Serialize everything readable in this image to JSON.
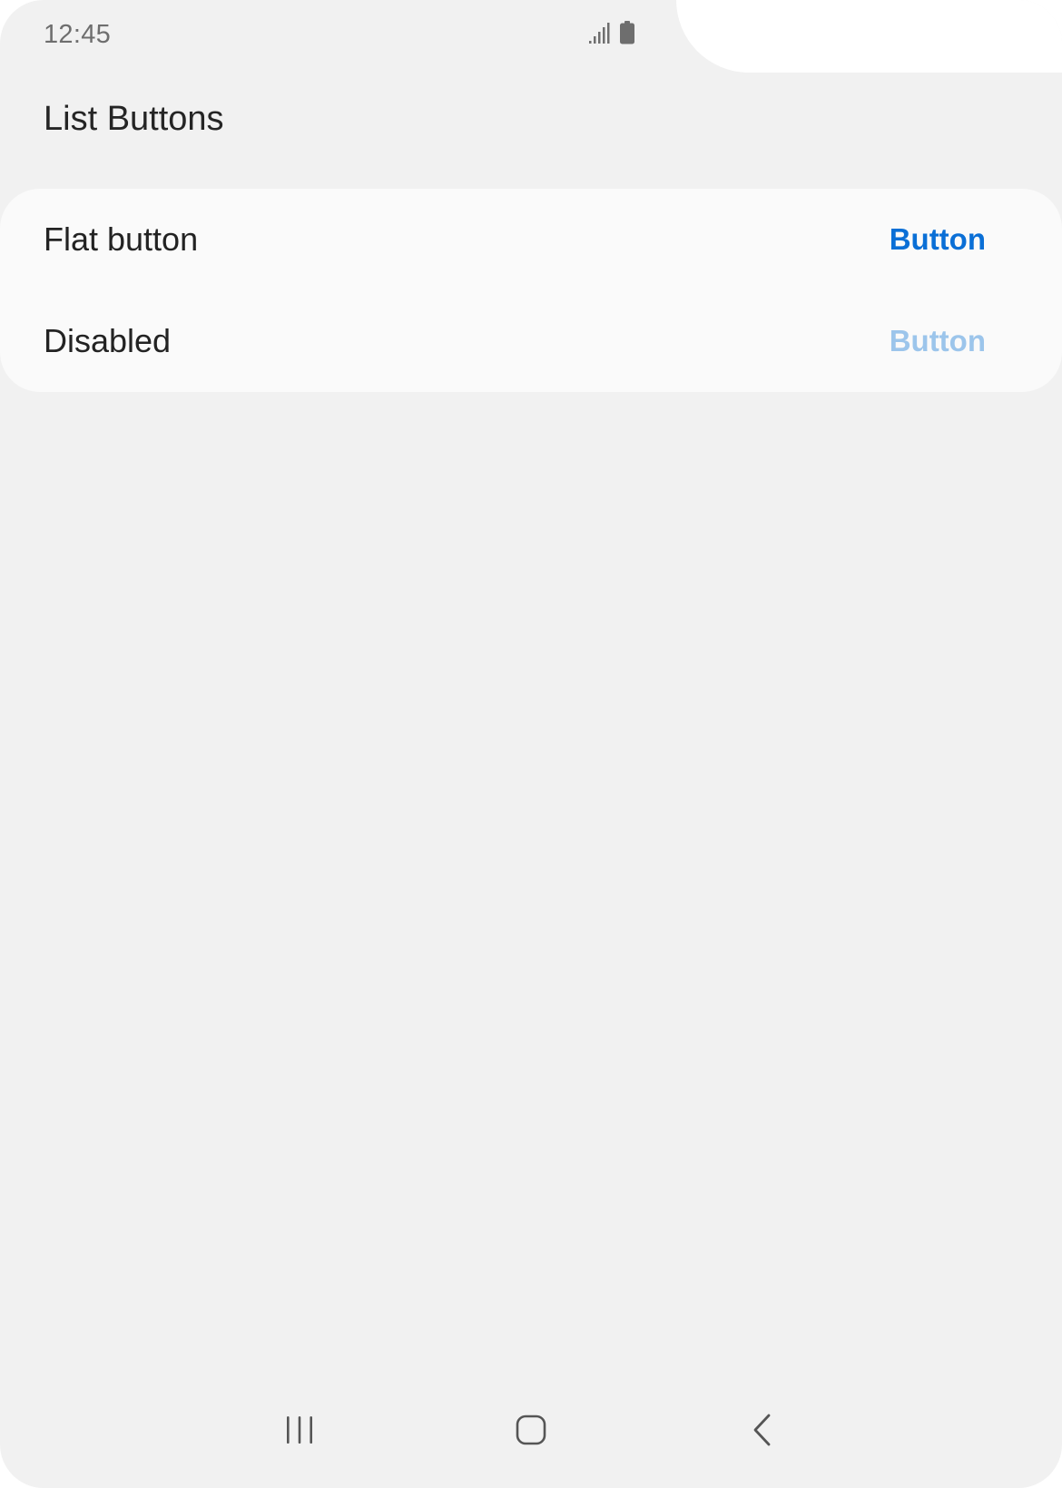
{
  "status_bar": {
    "time": "12:45",
    "icons": [
      "signal-icon",
      "battery-icon"
    ]
  },
  "page": {
    "title": "List Buttons"
  },
  "list": {
    "rows": [
      {
        "label": "Flat button",
        "button_label": "Button",
        "enabled": true
      },
      {
        "label": "Disabled",
        "button_label": "Button",
        "enabled": false
      }
    ]
  },
  "nav_bar": {
    "icons": [
      "recent-apps-icon",
      "home-icon",
      "back-icon"
    ]
  },
  "colors": {
    "background": "#f1f1f1",
    "card": "#fafafa",
    "accent": "#0a6fd6",
    "accent_disabled": "#9cc5eb",
    "text_primary": "#232323",
    "icon_gray": "#6e6e6e"
  }
}
